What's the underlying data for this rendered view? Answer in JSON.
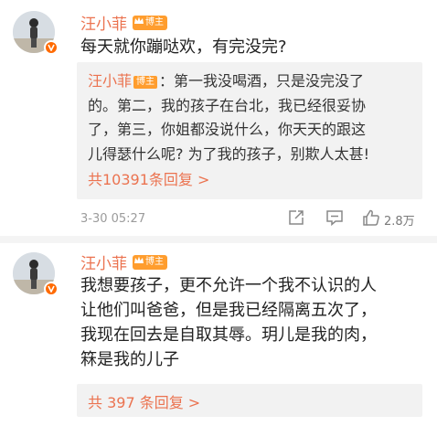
{
  "comments": [
    {
      "author": "汪小菲",
      "badge": "博主",
      "text": "每天就你蹦哒欢，有完没完?",
      "quote": {
        "author": "汪小菲",
        "badge": "博主",
        "lines": [
          "：第一我没喝酒，只是没完没了",
          "的。第二，我的孩子在台北，我已经很妥协",
          "了，第三，你姐都没说什么，你天天的跟这",
          "儿得瑟什么呢? 为了我的孩子，别欺人太甚!"
        ],
        "replies_label": "共10391条回复 >"
      },
      "time": "3-30 05:27",
      "likes": "2.8万"
    },
    {
      "author": "汪小菲",
      "badge": "博主",
      "text_lines": [
        "我想要孩子，更不允许一个我不认识的人",
        "让他们叫爸爸，但是我已经隔离五次了，",
        "我现在回去是自取其辱。玥儿是我的肉，",
        "箖是我的儿子"
      ],
      "replies_label": "共 397 条回复 >"
    }
  ],
  "colors": {
    "author": "#eb7350",
    "badge": "#ff9d2e",
    "verified": "#ff6a00"
  },
  "icons": [
    "verified-v-icon",
    "crown-icon",
    "share-icon",
    "comment-icon",
    "like-icon"
  ]
}
